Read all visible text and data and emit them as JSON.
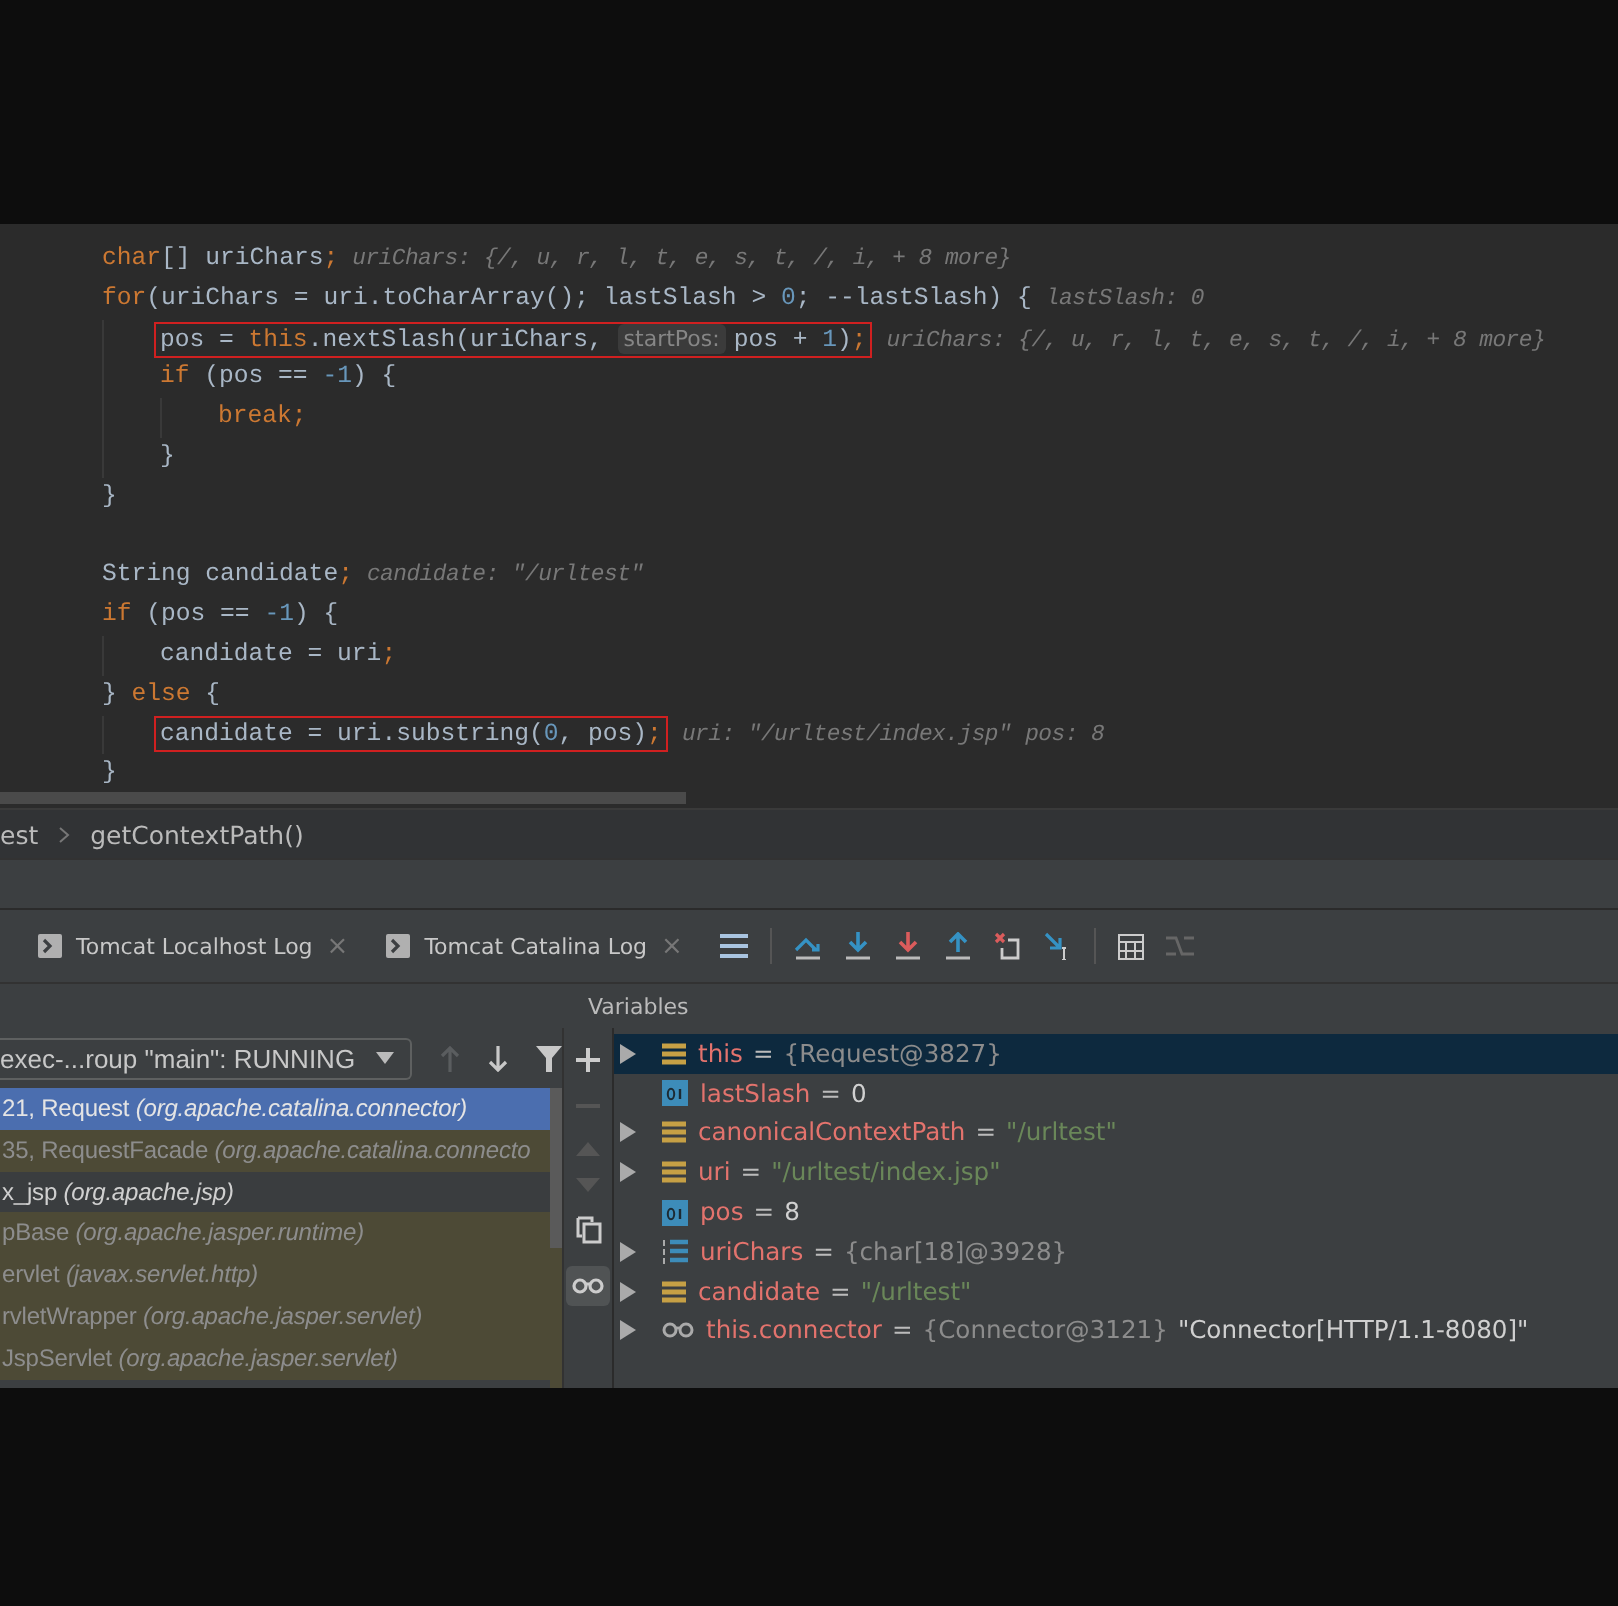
{
  "editor": {
    "lines": [
      {
        "tokens": [
          {
            "kind": "kw",
            "text": "char"
          },
          {
            "kind": "id",
            "text": "[] uriChars"
          },
          {
            "kind": "kw",
            "text": ";"
          },
          {
            "kind": "hint",
            "text": "uriChars: {/, u, r, l, t, e, s, t, /, i, + 8 more}"
          }
        ]
      },
      {
        "tokens": [
          {
            "kind": "kw",
            "text": "for"
          },
          {
            "kind": "id",
            "text": "(uriChars = uri.toCharArray(); lastSlash > "
          },
          {
            "kind": "num",
            "text": "0"
          },
          {
            "kind": "id",
            "text": "; --lastSlash) {"
          },
          {
            "kind": "hint",
            "text": "lastSlash: 0"
          }
        ],
        "children": [
          {
            "boxed": true,
            "tokens": [
              {
                "kind": "id",
                "text": "pos = "
              },
              {
                "kind": "kw",
                "text": "this"
              },
              {
                "kind": "id",
                "text": ".nextSlash(uriChars, "
              },
              {
                "kind": "param",
                "text": "startPos:"
              },
              {
                "kind": "id",
                "text": "pos + "
              },
              {
                "kind": "num",
                "text": "1"
              },
              {
                "kind": "id",
                "text": ")"
              },
              {
                "kind": "kw",
                "text": ";"
              },
              {
                "kind": "hint",
                "text": "uriChars: {/, u, r, l, t, e, s, t, /, i, + 8 more}"
              }
            ]
          },
          {
            "tokens": [
              {
                "kind": "kw",
                "text": "if"
              },
              {
                "kind": "id",
                "text": " (pos == "
              },
              {
                "kind": "num",
                "text": "-1"
              },
              {
                "kind": "id",
                "text": ") {"
              }
            ],
            "children": [
              {
                "tokens": [
                  {
                    "kind": "kw",
                    "text": "break;"
                  }
                ]
              }
            ]
          },
          {
            "tokens": [
              {
                "kind": "id",
                "text": "}"
              }
            ]
          }
        ]
      },
      {
        "tokens": [
          {
            "kind": "id",
            "text": "}"
          }
        ]
      },
      {
        "blank_before": true,
        "tokens": [
          {
            "kind": "id",
            "text": "String candidate"
          },
          {
            "kind": "kw",
            "text": ";"
          },
          {
            "kind": "hint",
            "text": "candidate: \"/urltest\""
          }
        ]
      },
      {
        "tokens": [
          {
            "kind": "kw",
            "text": "if"
          },
          {
            "kind": "id",
            "text": " (pos == "
          },
          {
            "kind": "num",
            "text": "-1"
          },
          {
            "kind": "id",
            "text": ") {"
          }
        ],
        "children": [
          {
            "tokens": [
              {
                "kind": "id",
                "text": "candidate = uri"
              },
              {
                "kind": "kw",
                "text": ";"
              }
            ]
          }
        ]
      },
      {
        "tokens": [
          {
            "kind": "id",
            "text": "} "
          },
          {
            "kind": "kw",
            "text": "else"
          },
          {
            "kind": "id",
            "text": " {"
          }
        ],
        "children": [
          {
            "boxed": true,
            "tokens": [
              {
                "kind": "id",
                "text": "candidate = uri.substring("
              },
              {
                "kind": "num",
                "text": "0"
              },
              {
                "kind": "id",
                "text": ", pos)"
              },
              {
                "kind": "kw",
                "text": ";"
              },
              {
                "kind": "hint",
                "text": "uri: \"/urltest/index.jsp\""
              },
              {
                "kind": "hint",
                "text": "pos: 8"
              }
            ]
          }
        ]
      },
      {
        "tokens": [
          {
            "kind": "id",
            "text": "}"
          }
        ]
      }
    ]
  },
  "breadcrumb": [
    "est",
    "getContextPath()"
  ],
  "tabs": [
    {
      "label": "Tomcat Localhost Log",
      "close": "×"
    },
    {
      "label": "Tomcat Catalina Log",
      "close": "×"
    }
  ],
  "variables_header": "Variables",
  "thread_selector": {
    "value": "exec-...roup \"main\": RUNNING"
  },
  "frames": [
    {
      "method": "21, Request",
      "package": "(org.apache.catalina.connector)",
      "selected": true,
      "kind": "library"
    },
    {
      "method": "35, RequestFacade",
      "package": "(org.apache.catalina.connecto",
      "selected": false,
      "kind": "library"
    },
    {
      "method": "x_jsp",
      "package": "(org.apache.jsp)",
      "selected": false,
      "kind": "user"
    },
    {
      "method": "pBase",
      "package": "(org.apache.jasper.runtime)",
      "selected": false,
      "kind": "library"
    },
    {
      "method": "ervlet",
      "package": "(javax.servlet.http)",
      "selected": false,
      "kind": "library"
    },
    {
      "method": "rvletWrapper",
      "package": "(org.apache.jasper.servlet)",
      "selected": false,
      "kind": "library"
    },
    {
      "method": "JspServlet",
      "package": "(org.apache.jasper.servlet)",
      "selected": false,
      "kind": "library"
    }
  ],
  "variables": [
    {
      "kind": "field",
      "name": "this",
      "eq": "=",
      "value": {
        "kind": "object",
        "text": "{Request@3827}"
      },
      "expandable": true,
      "selected": true
    },
    {
      "kind": "primitive",
      "name": "lastSlash",
      "eq": "=",
      "value": {
        "kind": "number",
        "text": "0"
      },
      "expandable": false,
      "selected": false
    },
    {
      "kind": "field",
      "name": "canonicalContextPath",
      "eq": "=",
      "value": {
        "kind": "string",
        "text": "\"/urltest\""
      },
      "expandable": true,
      "selected": false
    },
    {
      "kind": "field",
      "name": "uri",
      "eq": "=",
      "value": {
        "kind": "string",
        "text": "\"/urltest/index.jsp\""
      },
      "expandable": true,
      "selected": false
    },
    {
      "kind": "primitive",
      "name": "pos",
      "eq": "=",
      "value": {
        "kind": "number",
        "text": "8"
      },
      "expandable": false,
      "selected": false
    },
    {
      "kind": "array",
      "name": "uriChars",
      "eq": "=",
      "value": {
        "kind": "object",
        "text": "{char[18]@3928}"
      },
      "expandable": true,
      "selected": false
    },
    {
      "kind": "field",
      "name": "candidate",
      "eq": "=",
      "value": {
        "kind": "string",
        "text": "\"/urltest\""
      },
      "expandable": true,
      "selected": false
    },
    {
      "kind": "watch",
      "name": "this.connector",
      "eq": "=",
      "value": {
        "kind": "object",
        "text": "{Connector@3121}"
      },
      "extra": "\"Connector[HTTP/1.1-8080]\"",
      "expandable": true,
      "selected": false
    }
  ]
}
